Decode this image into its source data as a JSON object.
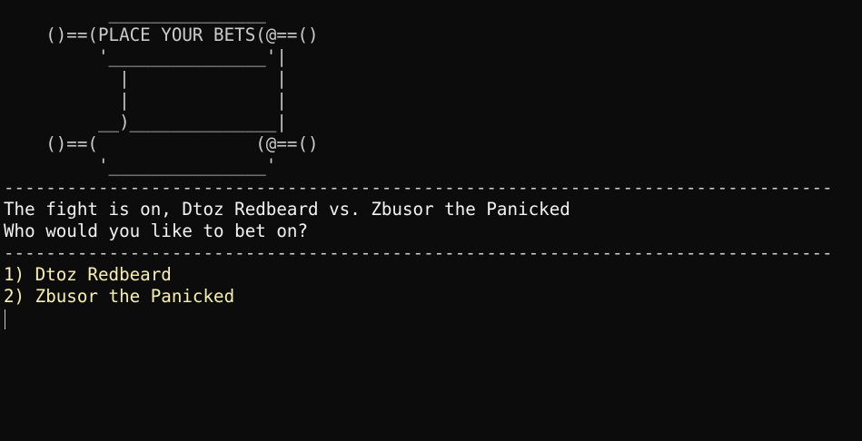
{
  "ascii_art": [
    "          _______________",
    "    ()==(PLACE YOUR BETS(@==()",
    "         '_______________'|",
    "           |              |",
    "           |              |",
    "         __)______________|",
    "    ()==(               (@==()",
    "         '_______________'"
  ],
  "divider_top": "-------------------------------------------------------------------------------",
  "fight_message": "The fight is on, Dtoz Redbeard vs. Zbusor the Panicked",
  "prompt": "Who would you like to bet on?",
  "divider_bottom": "-------------------------------------------------------------------------------",
  "options": [
    "1) Dtoz Redbeard",
    "2) Zbusor the Panicked"
  ],
  "colors": {
    "background": "#0c0c0c",
    "text": "#cccccc",
    "bright_text": "#f2f2f2",
    "option_text": "#f9f1a5"
  }
}
